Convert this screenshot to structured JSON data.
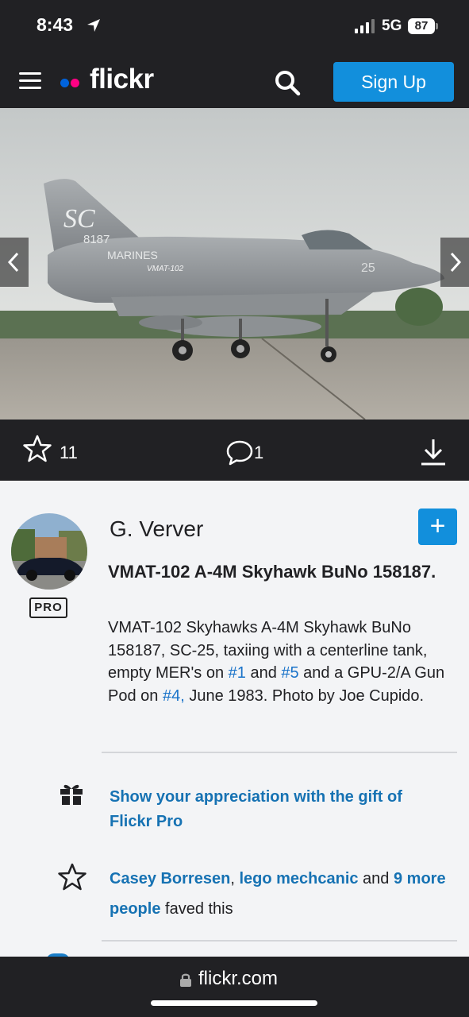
{
  "status": {
    "time": "8:43",
    "network": "5G",
    "battery": "87"
  },
  "nav": {
    "logo": "flickr",
    "signup_label": "Sign Up",
    "dot_colors": {
      "blue": "#0063dc",
      "pink": "#ff0084"
    }
  },
  "photo": {
    "tail_code": "SC",
    "tail_number": "8187",
    "fuselage_text": "MARINES",
    "squadron_text": "VMAT-102",
    "nose_number": "25"
  },
  "actions": {
    "faves_count": "11",
    "comments_count": "1"
  },
  "owner": {
    "name": "G. Verver",
    "badge": "PRO",
    "follow_label": "+"
  },
  "title": "VMAT-102 A-4M Skyhawk BuNo 158187.",
  "description": {
    "part1": "VMAT-102 Skyhawks A-4M Skyhawk BuNo 158187, SC-25, taxiing with a centerline tank, empty MER's on ",
    "link1": "#1",
    "part2": " and ",
    "link2": "#5",
    "part3": " and a GPU-2/A Gun Pod on ",
    "link3": "#4,",
    "part4": " June 1983. Photo by Joe Cupido."
  },
  "gift": {
    "text": "Show your appreciation with the gift of Flickr Pro"
  },
  "faves_line": {
    "user1": "Casey Borresen",
    "sep": ", ",
    "user2": "lego mechcanic",
    "and": " and ",
    "more": "9 more people",
    "suffix": " faved this"
  },
  "browser": {
    "url": "flickr.com"
  },
  "colors": {
    "accent": "#128fdc",
    "link": "#1672b3",
    "dark_bar": "#212124"
  }
}
